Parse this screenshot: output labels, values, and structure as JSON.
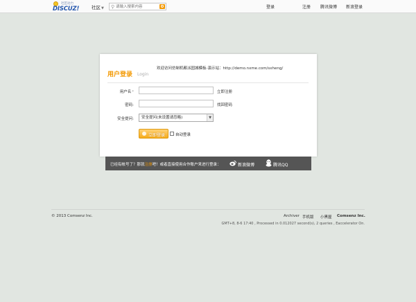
{
  "header": {
    "logo_tagline": "社区动力",
    "logo_word": "DISCUZ!",
    "community_label": "社区",
    "search": {
      "placeholder": "请输入搜索内容"
    },
    "links": [
      "登录",
      "注册",
      "腾讯微博",
      "新浪登录"
    ]
  },
  "login": {
    "notice": "欢迎访问仿制机都派园城模板-演示站：http://demo.nxme.com/sxheng/",
    "title": "用户登录",
    "subtitle": "Login",
    "username_label": "用户名",
    "username_asterisk": "*",
    "username_value": "",
    "register_link": "立即注册",
    "password_label": "密码:",
    "password_value": "",
    "forgot_link": "找回密码",
    "question_label": "安全提问:",
    "question_selected": "安全提问(未设置请忽略)",
    "submit_label": "立即登录",
    "remember_label": "自动登录",
    "remember_checked": false
  },
  "social": {
    "prompt_pre": "已经有帐号了？那就",
    "prompt_link": "注册",
    "prompt_post": "吧！或者直接使用合作账户来进行登录：",
    "weibo_label": "新浪微博",
    "qq_label": "腾讯QQ"
  },
  "footer": {
    "copyright": "© 2013 Comsenz Inc.",
    "links": [
      "Archiver",
      "手机版",
      "小黑屋"
    ],
    "company": "Comsenz Inc.",
    "gmt": "GMT+8, 8-6 17:40 , Processed in 0.012027 second(s), 2 queries , Eaccelerator On."
  },
  "colors": {
    "accent": "#f39800",
    "background": "#e1e6e1",
    "strip": "#555555"
  },
  "icons": {
    "search": "search-icon",
    "weibo": "weibo-icon",
    "qq": "qq-icon",
    "logo": "discuz-logo"
  }
}
